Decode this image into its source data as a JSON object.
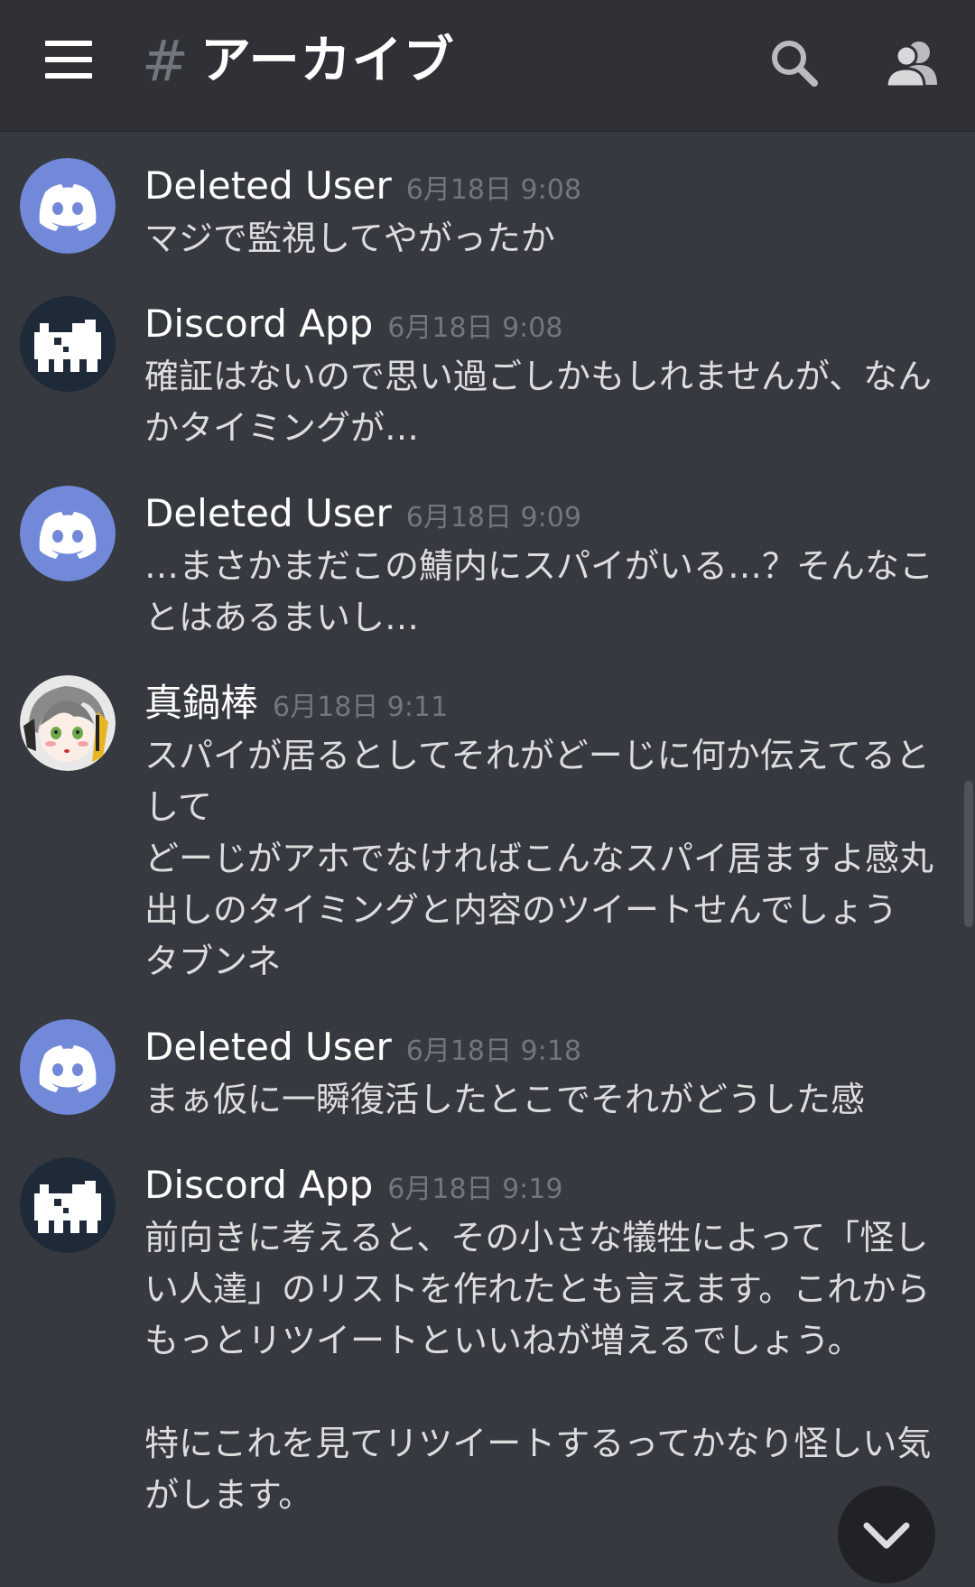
{
  "header": {
    "hash": "#",
    "channel_name": "アーカイブ"
  },
  "colors": {
    "background": "#36393f",
    "header": "#2f3136",
    "discord_blurple": "#7289da",
    "username": "#ffffff",
    "timestamp": "#72767d"
  },
  "messages": [
    {
      "author": "Deleted User",
      "timestamp": "6月18日 9:08",
      "avatar": "discord-logo-icon",
      "text": "マジで監視してやがったか"
    },
    {
      "author": "Discord App",
      "timestamp": "6月18日 9:08",
      "avatar": "pixel-creature-icon",
      "text": "確証はないので思い過ごしかもしれませんが、なん\nかタイミングが…"
    },
    {
      "author": "Deleted User",
      "timestamp": "6月18日 9:09",
      "avatar": "discord-logo-icon",
      "text": "…まさかまだこの鯖内にスパイがいる…？そんなこ\nとはあるまいし…"
    },
    {
      "author": "真鍋棒",
      "timestamp": "6月18日 9:11",
      "avatar": "anime-girl-avatar",
      "text": "スパイが居るとしてそれがどーじに何か伝えてると\nして\nどーじがアホでなければこんなスパイ居ますよ感丸\n出しのタイミングと内容のツイートせんでしょう\nタブンネ"
    },
    {
      "author": "Deleted User",
      "timestamp": "6月18日 9:18",
      "avatar": "discord-logo-icon",
      "text": "まぁ仮に一瞬復活したとこでそれがどうした感"
    },
    {
      "author": "Discord App",
      "timestamp": "6月18日 9:19",
      "avatar": "pixel-creature-icon",
      "text": "前向きに考えると、その小さな犠牲によって「怪し\nい人達」のリストを作れたとも言えます。これから\nもっとリツイートといいねが増えるでしょう。\n\n特にこれを見てリツイートするってかなり怪しい気\nがします。"
    }
  ]
}
